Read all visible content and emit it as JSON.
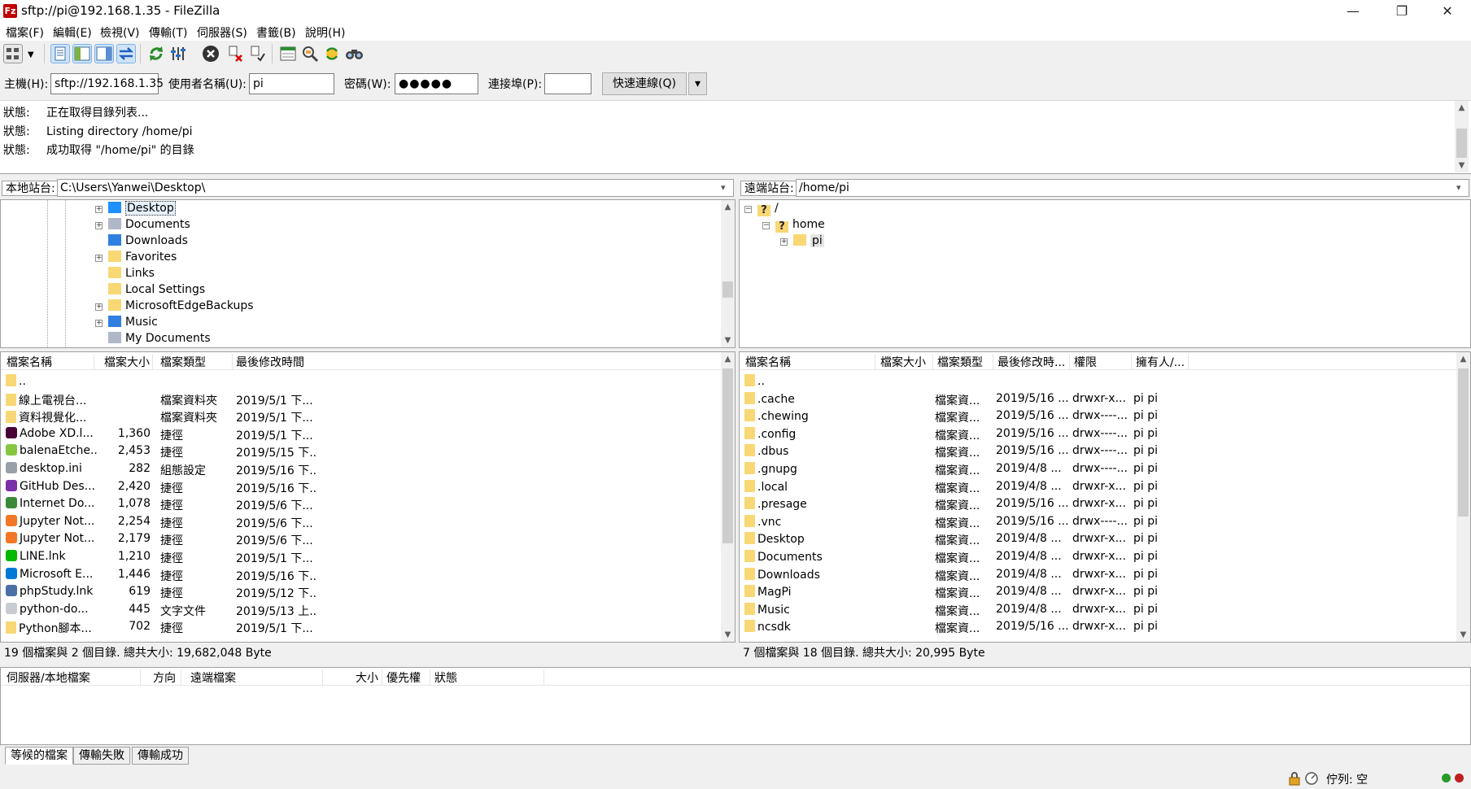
{
  "window": {
    "title": "sftp://pi@192.168.1.35 - FileZilla",
    "app_icon": "Fz",
    "minimize": "—",
    "maximize": "❐",
    "close": "✕"
  },
  "menu": [
    "檔案(F)",
    "編輯(E)",
    "檢視(V)",
    "傳輸(T)",
    "伺服器(S)",
    "書籤(B)",
    "說明(H)"
  ],
  "quickconnect": {
    "host_label": "主機(H):",
    "host_value": "sftp://192.168.1.35",
    "user_label": "使用者名稱(U):",
    "user_value": "pi",
    "pass_label": "密碼(W):",
    "pass_value": "●●●●●",
    "port_label": "連接埠(P):",
    "port_value": "",
    "connect_label": "快速連線(Q)",
    "dropdown": "▾"
  },
  "log": [
    {
      "key": "狀態:",
      "msg": "正在取得目錄列表..."
    },
    {
      "key": "狀態:",
      "msg": "Listing directory /home/pi"
    },
    {
      "key": "狀態:",
      "msg": "成功取得 \"/home/pi\" 的目錄"
    }
  ],
  "local": {
    "site_label": "本地站台:",
    "path": "C:\\Users\\Yanwei\\Desktop\\",
    "tree": [
      {
        "name": "Desktop",
        "icon": "desktop-icon",
        "expand": "+",
        "color": "#1e90ff"
      },
      {
        "name": "Documents",
        "icon": "documents-icon",
        "expand": "+",
        "color": "#b0b8c8"
      },
      {
        "name": "Downloads",
        "icon": "download-arrow-icon",
        "expand": "",
        "color": "#2f7fe0"
      },
      {
        "name": "Favorites",
        "icon": "favorites-folder-icon",
        "expand": "+",
        "color": "#f8d775"
      },
      {
        "name": "Links",
        "icon": "links-folder-icon",
        "expand": "",
        "color": "#f8d775"
      },
      {
        "name": "Local Settings",
        "icon": "folder-icon",
        "expand": "",
        "color": "#f8d775"
      },
      {
        "name": "MicrosoftEdgeBackups",
        "icon": "folder-icon",
        "expand": "+",
        "color": "#f8d775"
      },
      {
        "name": "Music",
        "icon": "music-icon",
        "expand": "+",
        "color": "#2f7fe0"
      },
      {
        "name": "My Documents",
        "icon": "documents-icon",
        "expand": "",
        "color": "#b0b8c8"
      }
    ],
    "columns": [
      "檔案名稱",
      "檔案大小",
      "檔案類型",
      "最後修改時間"
    ],
    "files": [
      {
        "name": "..",
        "size": "",
        "type": "",
        "date": "",
        "icon": "folder-icon",
        "color": "#f8d775"
      },
      {
        "name": "線上電視台...",
        "size": "",
        "type": "檔案資料夾",
        "date": "2019/5/1 下...",
        "icon": "folder-icon",
        "color": "#f8d775"
      },
      {
        "name": "資料視覺化...",
        "size": "",
        "type": "檔案資料夾",
        "date": "2019/5/1 下...",
        "icon": "folder-icon",
        "color": "#f8d775"
      },
      {
        "name": "Adobe XD.l...",
        "size": "1,360",
        "type": "捷徑",
        "date": "2019/5/1 下...",
        "icon": "adobe-xd-icon",
        "color": "#470137"
      },
      {
        "name": "balenaEtche...",
        "size": "2,453",
        "type": "捷徑",
        "date": "2019/5/15 下...",
        "icon": "balena-etcher-icon",
        "color": "#85c840"
      },
      {
        "name": "desktop.ini",
        "size": "282",
        "type": "組態設定",
        "date": "2019/5/16 下...",
        "icon": "settings-file-icon",
        "color": "#9aa0a8"
      },
      {
        "name": "GitHub Des...",
        "size": "2,420",
        "type": "捷徑",
        "date": "2019/5/16 下...",
        "icon": "github-desktop-icon",
        "color": "#7b2fa8"
      },
      {
        "name": "Internet Do...",
        "size": "1,078",
        "type": "捷徑",
        "date": "2019/5/6 下...",
        "icon": "internet-download-icon",
        "color": "#3a8a3a"
      },
      {
        "name": "Jupyter Not...",
        "size": "2,254",
        "type": "捷徑",
        "date": "2019/5/6 下...",
        "icon": "jupyter-icon",
        "color": "#f37726"
      },
      {
        "name": "Jupyter Not...",
        "size": "2,179",
        "type": "捷徑",
        "date": "2019/5/6 下...",
        "icon": "jupyter-icon",
        "color": "#f37726"
      },
      {
        "name": "LINE.lnk",
        "size": "1,210",
        "type": "捷徑",
        "date": "2019/5/1 下...",
        "icon": "line-app-icon",
        "color": "#00b900"
      },
      {
        "name": "Microsoft E...",
        "size": "1,446",
        "type": "捷徑",
        "date": "2019/5/16 下...",
        "icon": "edge-icon",
        "color": "#0078d7"
      },
      {
        "name": "phpStudy.lnk",
        "size": "619",
        "type": "捷徑",
        "date": "2019/5/12 下...",
        "icon": "phpstudy-icon",
        "color": "#4a6fa5"
      },
      {
        "name": "python-do...",
        "size": "445",
        "type": "文字文件",
        "date": "2019/5/13 上...",
        "icon": "text-file-icon",
        "color": "#c8ccd2"
      },
      {
        "name": "Python腳本...",
        "size": "702",
        "type": "捷徑",
        "date": "2019/5/1 下...",
        "icon": "folder-icon",
        "color": "#f8d775"
      }
    ],
    "summary": "19 個檔案與 2 個目錄. 總共大小: 19,682,048 Byte"
  },
  "remote": {
    "site_label": "遠端站台:",
    "path": "/home/pi",
    "tree": [
      {
        "name": "/",
        "icon": "unknown-folder-icon",
        "expand": "−",
        "indent": 0
      },
      {
        "name": "home",
        "icon": "unknown-folder-icon",
        "expand": "−",
        "indent": 1
      },
      {
        "name": "pi",
        "icon": "folder-icon",
        "expand": "+",
        "indent": 2
      }
    ],
    "columns": [
      "檔案名稱",
      "檔案大小",
      "檔案類型",
      "最後修改時...",
      "權限",
      "擁有人/..."
    ],
    "files": [
      {
        "name": "..",
        "type": "",
        "date": "",
        "perm": "",
        "owner": ""
      },
      {
        "name": ".cache",
        "type": "檔案資...",
        "date": "2019/5/16 ...",
        "perm": "drwxr-x...",
        "owner": "pi pi"
      },
      {
        "name": ".chewing",
        "type": "檔案資...",
        "date": "2019/5/16 ...",
        "perm": "drwx----...",
        "owner": "pi pi"
      },
      {
        "name": ".config",
        "type": "檔案資...",
        "date": "2019/5/16 ...",
        "perm": "drwx----...",
        "owner": "pi pi"
      },
      {
        "name": ".dbus",
        "type": "檔案資...",
        "date": "2019/5/16 ...",
        "perm": "drwx----...",
        "owner": "pi pi"
      },
      {
        "name": ".gnupg",
        "type": "檔案資...",
        "date": "2019/4/8 ...",
        "perm": "drwx----...",
        "owner": "pi pi"
      },
      {
        "name": ".local",
        "type": "檔案資...",
        "date": "2019/4/8 ...",
        "perm": "drwxr-x...",
        "owner": "pi pi"
      },
      {
        "name": ".presage",
        "type": "檔案資...",
        "date": "2019/5/16 ...",
        "perm": "drwxr-x...",
        "owner": "pi pi"
      },
      {
        "name": ".vnc",
        "type": "檔案資...",
        "date": "2019/5/16 ...",
        "perm": "drwx----...",
        "owner": "pi pi"
      },
      {
        "name": "Desktop",
        "type": "檔案資...",
        "date": "2019/4/8 ...",
        "perm": "drwxr-x...",
        "owner": "pi pi"
      },
      {
        "name": "Documents",
        "type": "檔案資...",
        "date": "2019/4/8 ...",
        "perm": "drwxr-x...",
        "owner": "pi pi"
      },
      {
        "name": "Downloads",
        "type": "檔案資...",
        "date": "2019/4/8 ...",
        "perm": "drwxr-x...",
        "owner": "pi pi"
      },
      {
        "name": "MagPi",
        "type": "檔案資...",
        "date": "2019/4/8 ...",
        "perm": "drwxr-x...",
        "owner": "pi pi"
      },
      {
        "name": "Music",
        "type": "檔案資...",
        "date": "2019/4/8 ...",
        "perm": "drwxr-x...",
        "owner": "pi pi"
      },
      {
        "name": "ncsdk",
        "type": "檔案資...",
        "date": "2019/5/16 ...",
        "perm": "drwxr-x...",
        "owner": "pi pi"
      }
    ],
    "summary": "7 個檔案與 18 個目錄. 總共大小: 20,995 Byte"
  },
  "queue": {
    "columns": [
      "伺服器/本地檔案",
      "方向",
      "遠端檔案",
      "大小",
      "優先權",
      "狀態"
    ],
    "tabs": [
      "等候的檔案",
      "傳輸失敗",
      "傳輸成功"
    ]
  },
  "statusbar": {
    "queue_label": "佇列: 空"
  },
  "colors": {
    "accent": "#0078d7",
    "folder": "#f8d775",
    "brand_red": "#bf0000"
  }
}
